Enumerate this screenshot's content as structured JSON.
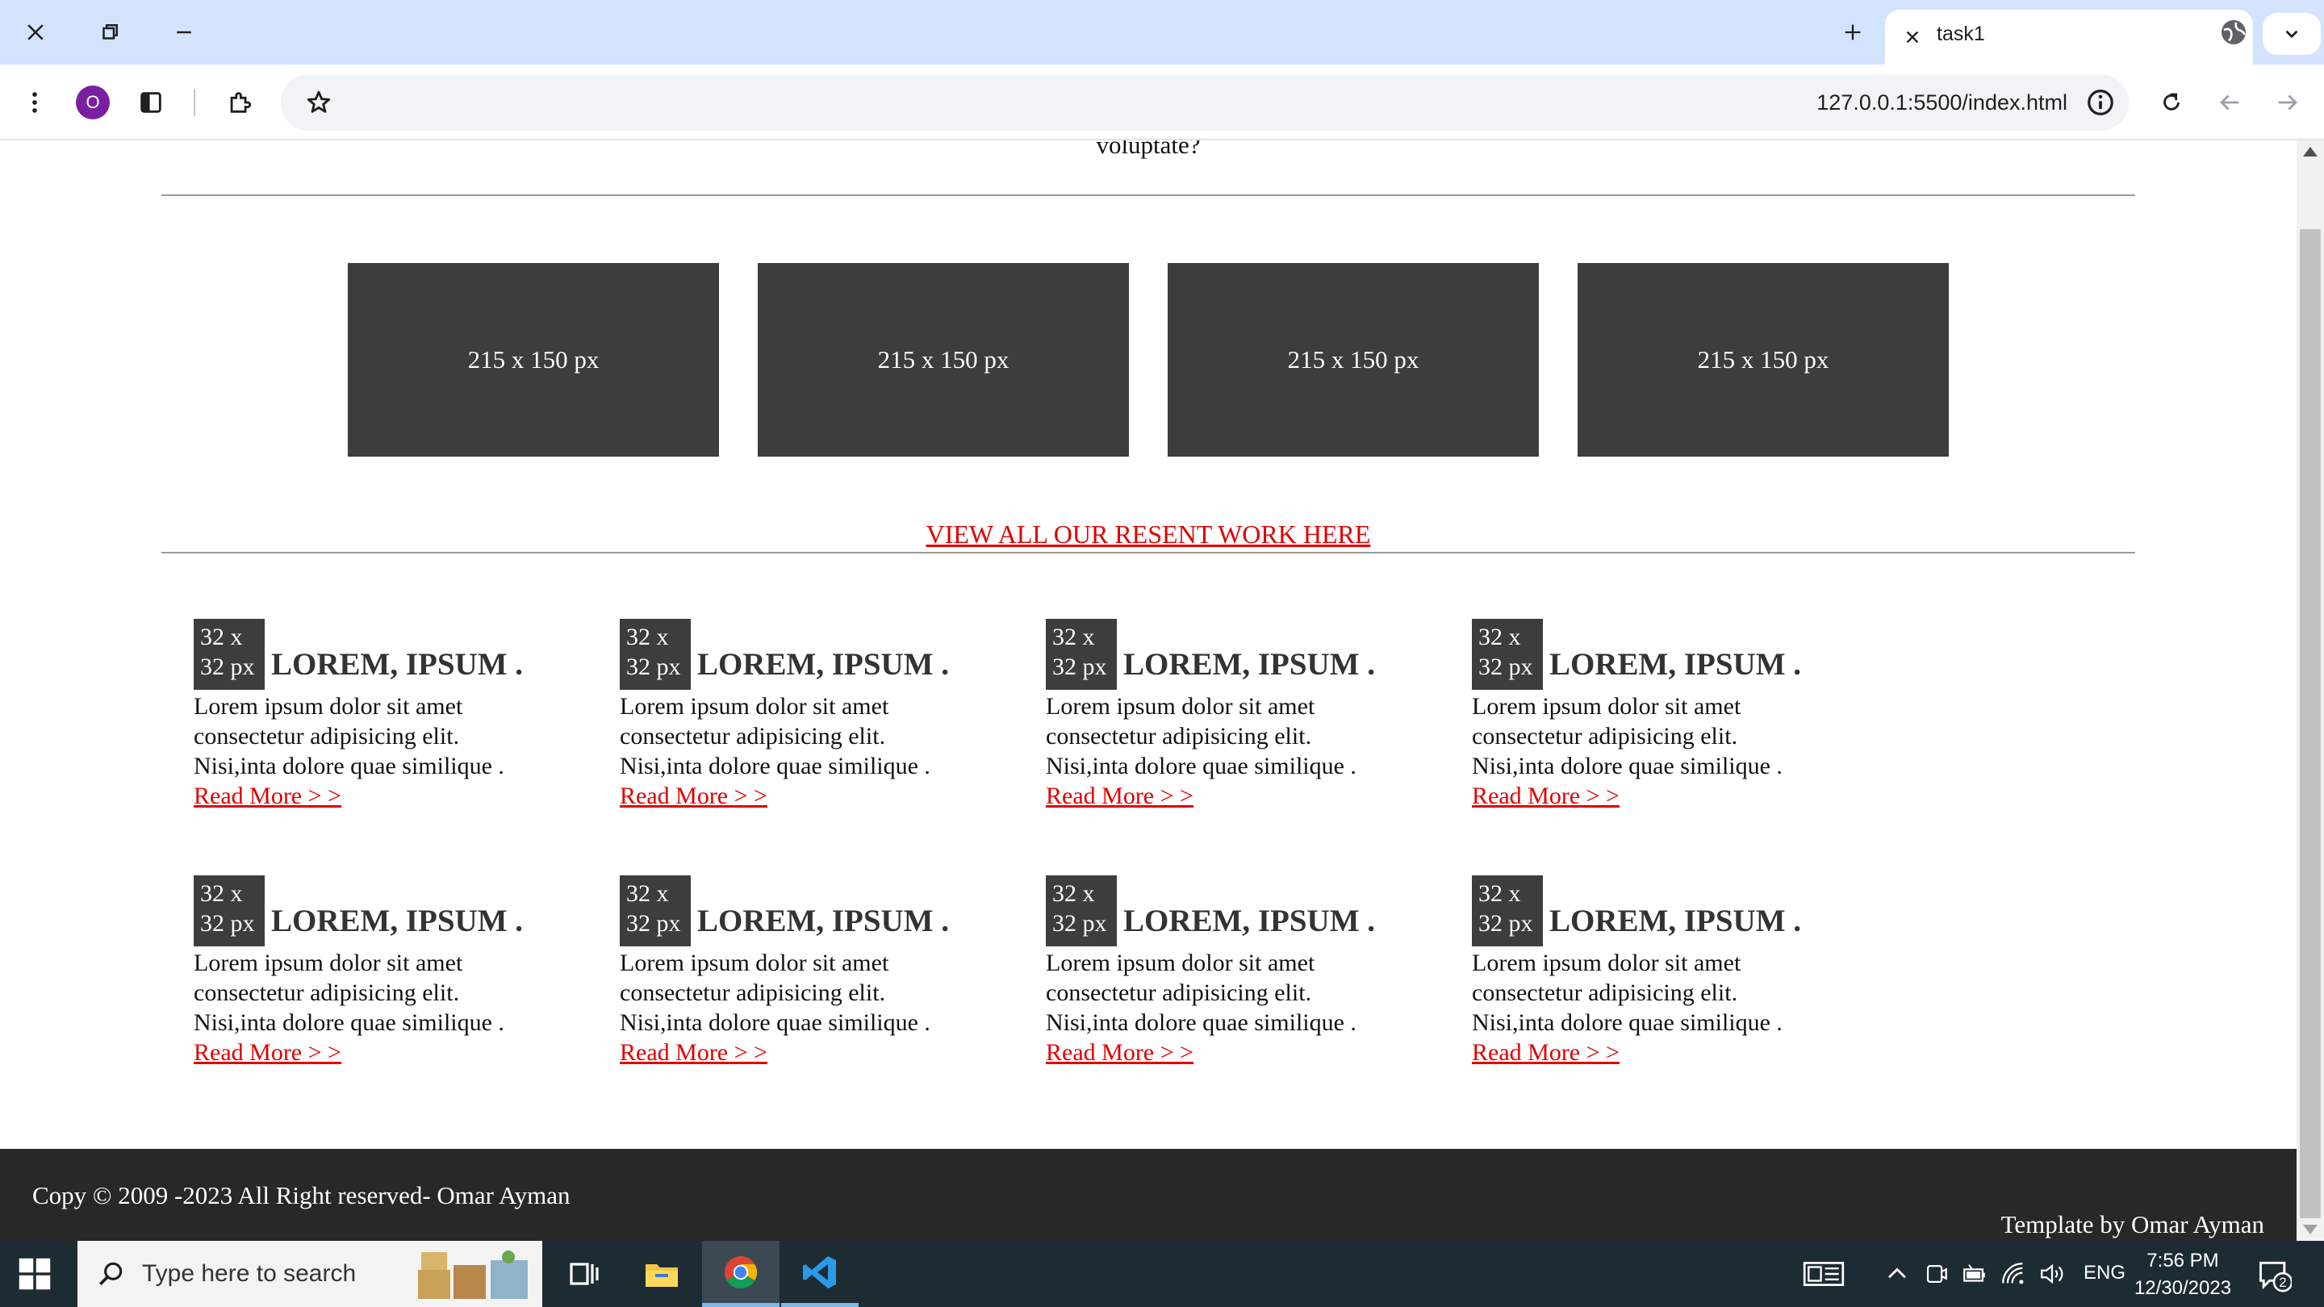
{
  "browser": {
    "tab_title": "task1",
    "url": "127.0.0.1:5500/index.html",
    "profile_initial": "O"
  },
  "page": {
    "partial_text": "voluptate?",
    "thumbnails": [
      "215 x 150 px",
      "215 x 150 px",
      "215 x 150 px",
      "215 x 150 px"
    ],
    "view_all_link": "VIEW ALL OUR RESENT WORK HERE",
    "features": [
      {
        "icon_line1": "32 x",
        "icon_line2": "32 px",
        "title": "LOREM, IPSUM .",
        "line1": "Lorem ipsum dolor sit amet",
        "line2": "consectetur adipisicing elit.",
        "line3": "Nisi,inta dolore quae similique .",
        "link": "Read More > >"
      },
      {
        "icon_line1": "32 x",
        "icon_line2": "32 px",
        "title": "LOREM, IPSUM .",
        "line1": "Lorem ipsum dolor sit amet",
        "line2": "consectetur adipisicing elit.",
        "line3": "Nisi,inta dolore quae similique .",
        "link": "Read More > >"
      },
      {
        "icon_line1": "32 x",
        "icon_line2": "32 px",
        "title": "LOREM, IPSUM .",
        "line1": "Lorem ipsum dolor sit amet",
        "line2": "consectetur adipisicing elit.",
        "line3": "Nisi,inta dolore quae similique .",
        "link": "Read More > >"
      },
      {
        "icon_line1": "32 x",
        "icon_line2": "32 px",
        "title": "LOREM, IPSUM .",
        "line1": "Lorem ipsum dolor sit amet",
        "line2": "consectetur adipisicing elit.",
        "line3": "Nisi,inta dolore quae similique .",
        "link": "Read More > >"
      },
      {
        "icon_line1": "32 x",
        "icon_line2": "32 px",
        "title": "LOREM, IPSUM .",
        "line1": "Lorem ipsum dolor sit amet",
        "line2": "consectetur adipisicing elit.",
        "line3": "Nisi,inta dolore quae similique .",
        "link": "Read More > >"
      },
      {
        "icon_line1": "32 x",
        "icon_line2": "32 px",
        "title": "LOREM, IPSUM .",
        "line1": "Lorem ipsum dolor sit amet",
        "line2": "consectetur adipisicing elit.",
        "line3": "Nisi,inta dolore quae similique .",
        "link": "Read More > >"
      },
      {
        "icon_line1": "32 x",
        "icon_line2": "32 px",
        "title": "LOREM, IPSUM .",
        "line1": "Lorem ipsum dolor sit amet",
        "line2": "consectetur adipisicing elit.",
        "line3": "Nisi,inta dolore quae similique .",
        "link": "Read More > >"
      },
      {
        "icon_line1": "32 x",
        "icon_line2": "32 px",
        "title": "LOREM, IPSUM .",
        "line1": "Lorem ipsum dolor sit amet",
        "line2": "consectetur adipisicing elit.",
        "line3": "Nisi,inta dolore quae similique .",
        "link": "Read More > >"
      }
    ],
    "footer": {
      "copyright": "Copy © 2009 -2023 All Right reserved- Omar Ayman",
      "template": "Template by Omar Ayman"
    }
  },
  "taskbar": {
    "search_placeholder": "Type here to search",
    "language": "ENG",
    "time": "7:56 PM",
    "date": "12/30/2023",
    "notification_count": "2"
  },
  "colors": {
    "link": "#e00000",
    "placeholder_box": "#3d3d3d",
    "footer_bg": "#282828",
    "chrome_tabbar": "#d3e3fd"
  }
}
